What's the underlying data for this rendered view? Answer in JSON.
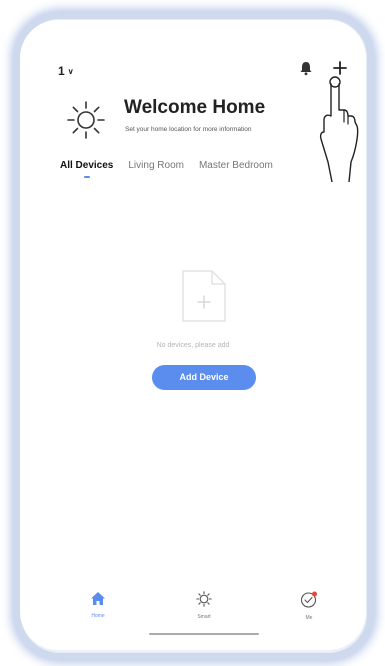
{
  "header": {
    "home_selector": "1",
    "title": "Welcome Home",
    "subtitle": "Set your home location for more information"
  },
  "icons": {
    "bell": "bell-icon",
    "add": "plus-icon",
    "weather": "sun-icon",
    "empty": "empty-document-icon",
    "pointer": "hand-pointer-icon"
  },
  "tabs": [
    {
      "label": "All Devices",
      "active": true
    },
    {
      "label": "Living Room",
      "active": false
    },
    {
      "label": "Master Bedroom",
      "active": false
    }
  ],
  "empty_state": {
    "message": "No devices, please add",
    "button_label": "Add Device"
  },
  "bottom_nav": [
    {
      "label": "Home",
      "active": true
    },
    {
      "label": "Smart",
      "active": false
    },
    {
      "label": "Me",
      "active": false
    }
  ],
  "colors": {
    "accent": "#5b8def",
    "notification_dot": "#e8483b",
    "frame_glow": "#b9c8e8"
  }
}
